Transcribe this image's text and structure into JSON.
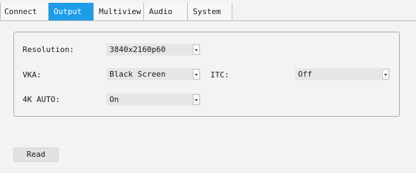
{
  "tabs": [
    {
      "label": "Connect"
    },
    {
      "label": "Output"
    },
    {
      "label": "Multiview"
    },
    {
      "label": "Audio"
    },
    {
      "label": "System"
    }
  ],
  "active_tab": "Output",
  "settings": {
    "resolution_label": "Resolution:",
    "resolution_value": "3840x2160p60",
    "vka_label": "VKA:",
    "vka_value": "Black Screen",
    "itc_label": "ITC:",
    "itc_value": "Off",
    "auto4k_label": "4K AUTO:",
    "auto4k_value": "On"
  },
  "read_button": "Read",
  "colors": {
    "active_tab": "#1f9ce8",
    "background": "#f3f3f3",
    "combo_bg": "#e6e6e6"
  }
}
